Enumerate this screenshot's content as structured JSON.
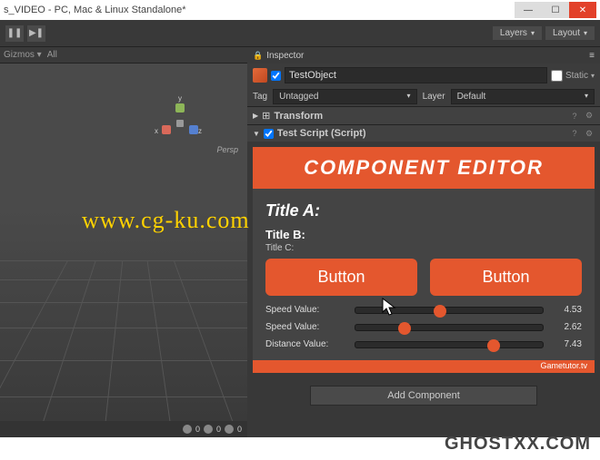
{
  "window": {
    "title": "s_VIDEO - PC, Mac & Linux Standalone*"
  },
  "toolbar": {
    "layers_label": "Layers",
    "layout_label": "Layout"
  },
  "scene": {
    "gizmos_label": "Gizmos",
    "all_label": "All",
    "persp_label": "Persp",
    "axis": {
      "x": "x",
      "y": "y",
      "z": "z"
    }
  },
  "inspector": {
    "tab_label": "Inspector",
    "object_name": "TestObject",
    "static_label": "Static",
    "tag_label": "Tag",
    "tag_value": "Untagged",
    "layer_label": "Layer",
    "layer_value": "Default",
    "components": {
      "transform": "Transform",
      "test_script": "Test Script (Script)"
    }
  },
  "editor": {
    "banner": "COMPONENT EDITOR",
    "title_a": "Title A:",
    "title_b": "Title B:",
    "title_c": "Title C:",
    "button1": "Button",
    "button2": "Button",
    "sliders": [
      {
        "label": "Speed Value:",
        "value": "4.53",
        "pct": 45
      },
      {
        "label": "Speed Value:",
        "value": "2.62",
        "pct": 26
      },
      {
        "label": "Distance Value:",
        "value": "7.43",
        "pct": 74
      }
    ],
    "footer": "Gametutor.tv",
    "add_component": "Add Component"
  },
  "watermarks": {
    "wm1": "www.cg-ku.com",
    "wm2": "GHOSTXX.COM"
  },
  "colors": {
    "accent": "#e4572e",
    "panel": "#383838"
  }
}
